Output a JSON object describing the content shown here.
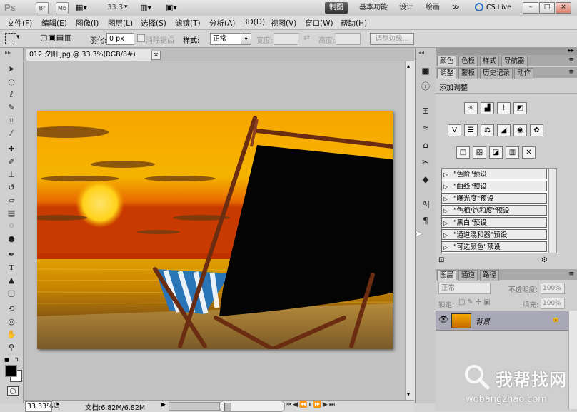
{
  "app": {
    "logo": "Ps",
    "zoom_field": "33.3",
    "workspaces": [
      "制图",
      "基本功能",
      "设计",
      "绘画"
    ],
    "more": "≫",
    "cs_live": "CS Live",
    "quick_buttons": [
      "Br",
      "Mb"
    ]
  },
  "menu": [
    "文件(F)",
    "编辑(E)",
    "图像(I)",
    "图层(L)",
    "选择(S)",
    "滤镜(T)",
    "分析(A)",
    "3D(D)",
    "视图(V)",
    "窗口(W)",
    "帮助(H)"
  ],
  "options": {
    "feather_label": "羽化:",
    "feather_value": "0 px",
    "antialias_label": "消除锯齿",
    "style_label": "样式:",
    "style_value": "正常",
    "width_label": "宽度:",
    "height_label": "高度:",
    "refine_edge": "调整边缘..."
  },
  "document": {
    "tab_title": "012 夕阳.jpg @ 33.3%(RGB/8#)",
    "close": "×"
  },
  "status": {
    "zoom": "33.33%",
    "doc_info": "文档:6.82M/6.82M"
  },
  "panels": {
    "top_tabs": [
      "颜色",
      "色板",
      "样式",
      "导航器"
    ],
    "adj_tabs": [
      "调整",
      "蒙板",
      "历史记录",
      "动作"
    ],
    "adj_title": "添加调整",
    "presets": [
      "\"色阶\"预设",
      "\"曲线\"预设",
      "\"曝光度\"预设",
      "\"色相/饱和度\"预设",
      "\"黑白\"预设",
      "\"通道混和器\"预设",
      "\"可选颜色\"预设"
    ],
    "layer_tabs": [
      "图层",
      "通道",
      "路径"
    ],
    "blend_mode": "正常",
    "opacity_label": "不透明度:",
    "opacity_value": "100%",
    "lock_label": "锁定:",
    "fill_label": "填充:",
    "fill_value": "100%",
    "layer_name": "背景"
  },
  "watermark": {
    "text": "我帮找网",
    "url": "wobangzhao.com"
  }
}
